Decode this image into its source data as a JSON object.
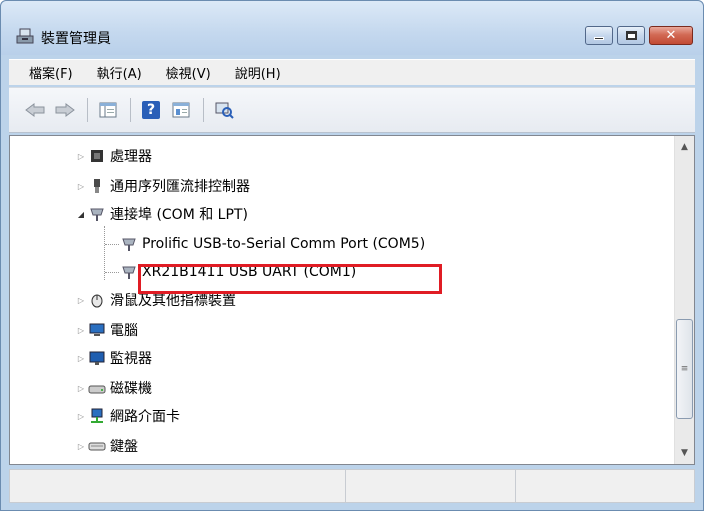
{
  "window": {
    "title": "裝置管理員",
    "close_glyph": "✕"
  },
  "menu": [
    {
      "label": "檔案(F)"
    },
    {
      "label": "執行(A)"
    },
    {
      "label": "檢視(V)"
    },
    {
      "label": "說明(H)"
    }
  ],
  "toolbar": {
    "help_glyph": "?"
  },
  "tree": [
    {
      "label": "處理器",
      "icon": "processor-icon"
    },
    {
      "label": "通用序列匯流排控制器",
      "icon": "usb-controller-icon"
    },
    {
      "label": "連接埠 (COM 和 LPT)",
      "icon": "port-icon"
    },
    {
      "label": "Prolific USB-to-Serial Comm Port (COM5)",
      "icon": "port-icon"
    },
    {
      "label": "XR21B1411 USB UART (COM1)",
      "icon": "port-icon"
    },
    {
      "label": "滑鼠及其他指標裝置",
      "icon": "mouse-icon"
    },
    {
      "label": "電腦",
      "icon": "computer-icon"
    },
    {
      "label": "監視器",
      "icon": "monitor-icon"
    },
    {
      "label": "磁碟機",
      "icon": "disk-drive-icon"
    },
    {
      "label": "網路介面卡",
      "icon": "network-adapter-icon"
    },
    {
      "label": "鍵盤",
      "icon": "keyboard-icon"
    }
  ],
  "scrollbar": {
    "up_arrow": "▲",
    "down_arrow": "▼",
    "grip": "≡"
  },
  "colors": {
    "highlight": "#e01c24",
    "titlebar": "#c4d8ee"
  }
}
